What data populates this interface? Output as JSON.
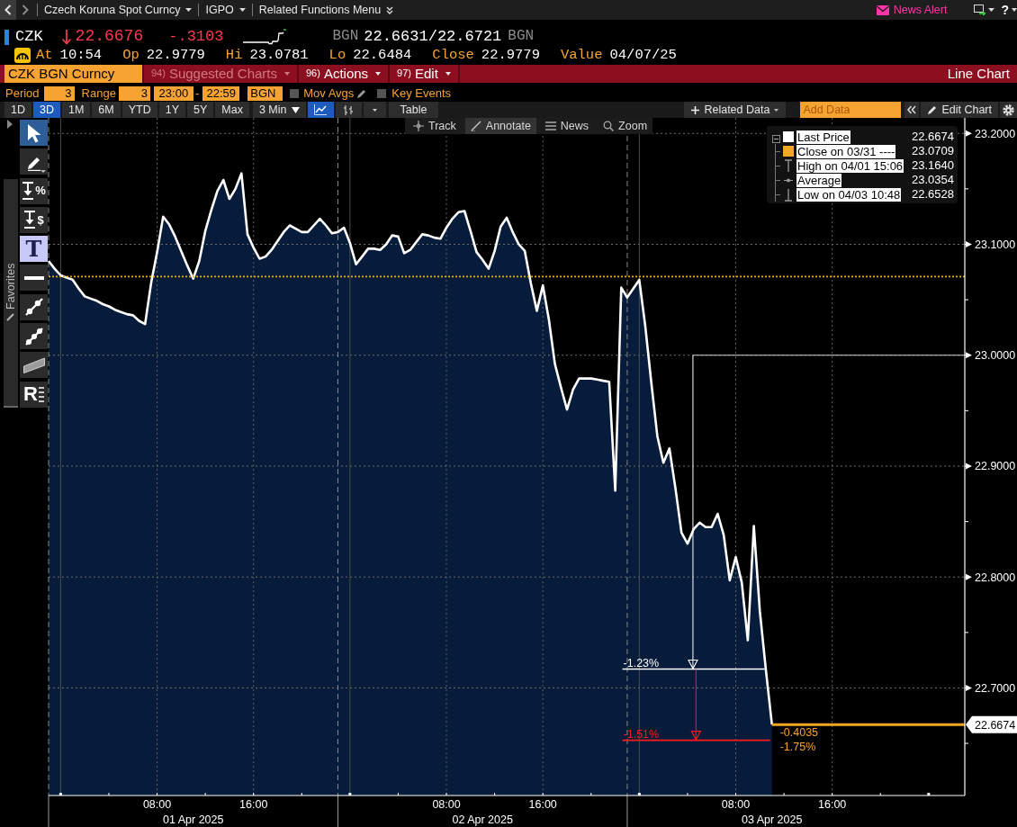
{
  "top_bar": {
    "menus": [
      {
        "label": "Czech Koruna Spot Curncy",
        "kind": "dropdown"
      },
      {
        "label": "IGPO",
        "kind": "dropdown"
      },
      {
        "label": "Related Functions Menu",
        "kind": "menu"
      }
    ],
    "news_alert": "News Alert",
    "help": "?"
  },
  "quote": {
    "ticker": "CZK",
    "down": true,
    "price": "22.6676",
    "change": "-.3103",
    "source_before": "BGN",
    "bid_ask": "22.6631/22.6721",
    "source_after": "BGN"
  },
  "quote_stats": [
    {
      "label": "At",
      "value": "10:54"
    },
    {
      "label": "Op",
      "value": "22.9779"
    },
    {
      "label": "Hi",
      "value": "23.0781"
    },
    {
      "label": "Lo",
      "value": "22.6484"
    },
    {
      "label": "Close",
      "value": "22.9779"
    },
    {
      "label": "Value",
      "value": "04/07/25"
    }
  ],
  "menu_bar": {
    "security": "CZK BGN Curncy",
    "items": [
      {
        "number": "94)",
        "label": "Suggested Charts",
        "disabled": true
      },
      {
        "number": "96)",
        "label": "Actions",
        "disabled": false
      },
      {
        "number": "97)",
        "label": "Edit",
        "disabled": false
      }
    ],
    "chart_type": "Line Chart"
  },
  "settings": {
    "period_label": "Period",
    "period": "3",
    "range_label": "Range",
    "range": "3",
    "start_time": "23:00",
    "time_separator": "-",
    "end_time": "22:59",
    "timezone": "BGN",
    "options": [
      {
        "label": "Mov Avgs",
        "checked": false,
        "editable": true
      },
      {
        "label": "Key Events",
        "checked": false,
        "editable": false
      }
    ]
  },
  "range_bar": {
    "ranges": [
      {
        "label": "1D",
        "selected": false
      },
      {
        "label": "3D",
        "selected": true
      },
      {
        "label": "1M",
        "selected": false
      },
      {
        "label": "6M",
        "selected": false
      },
      {
        "label": "YTD",
        "selected": false
      },
      {
        "label": "1Y",
        "selected": false
      },
      {
        "label": "5Y",
        "selected": false
      },
      {
        "label": "Max",
        "selected": false
      }
    ],
    "interval": "3 Min",
    "styles": [
      {
        "kind": "line",
        "selected": true
      },
      {
        "kind": "bars",
        "selected": false
      }
    ],
    "table": "Table",
    "related_data": "Related Data",
    "add_data_placeholder": "Add Data",
    "edit_chart": "Edit Chart"
  },
  "tools": [
    {
      "kind": "pointer",
      "selected": true,
      "highlighted": false
    },
    {
      "kind": "pencil",
      "selected": false,
      "highlighted": false
    },
    {
      "kind": "percent-drop",
      "glyph": "%",
      "selected": false,
      "highlighted": false
    },
    {
      "kind": "price-drop",
      "glyph": "$",
      "selected": false,
      "highlighted": false
    },
    {
      "kind": "text",
      "glyph": "T",
      "selected": false,
      "highlighted": true
    },
    {
      "kind": "horizontal-line",
      "selected": false,
      "highlighted": false
    },
    {
      "kind": "trend-line",
      "selected": false,
      "highlighted": false
    },
    {
      "kind": "multi-point-line",
      "selected": false,
      "highlighted": false
    },
    {
      "kind": "channel",
      "selected": false,
      "highlighted": false
    },
    {
      "kind": "ray-list",
      "glyph": "R",
      "selected": false,
      "highlighted": false
    }
  ],
  "favorites": "Favorites",
  "chart": {
    "toolbar": [
      {
        "kind": "track",
        "label": "Track",
        "selected": false
      },
      {
        "kind": "annotate",
        "label": "Annotate",
        "selected": true
      },
      {
        "kind": "news",
        "label": "News",
        "selected": false
      },
      {
        "kind": "zoom",
        "label": "Zoom",
        "selected": false
      }
    ],
    "legend": {
      "expanded": true,
      "items": [
        {
          "kind": "swatch",
          "color": "#ffffff",
          "label": "Last Price",
          "value": "22.6674"
        },
        {
          "kind": "swatch",
          "color": "#f5a623",
          "label": "Close on 03/31 ----",
          "value": "23.0709"
        },
        {
          "kind": "high",
          "label": "High on 04/01 15:06",
          "value": "23.1640"
        },
        {
          "kind": "average",
          "label": "Average",
          "value": "23.0354"
        },
        {
          "kind": "low",
          "label": "Low on 04/03 10:48",
          "value": "22.6528"
        }
      ]
    },
    "last_price_tag": "22.6674",
    "date_labels": [
      "01 Apr 2025",
      "02 Apr 2025",
      "03 Apr 2025"
    ],
    "chart_data": {
      "type": "area",
      "grid": true,
      "categories": [
        null,
        null,
        null,
        null,
        null,
        null,
        null,
        null,
        null,
        null,
        null,
        null,
        null,
        null,
        null,
        null,
        null,
        null,
        "08:00",
        null,
        null,
        null,
        null,
        null,
        null,
        null,
        null,
        null,
        null,
        null,
        null,
        null,
        null,
        null,
        "16:00",
        null,
        null,
        null,
        null,
        null,
        null,
        null,
        null,
        null,
        null,
        null,
        null,
        null,
        null,
        null,
        null,
        null,
        null,
        null,
        null,
        null,
        null,
        null,
        null,
        null,
        null,
        null,
        null,
        null,
        null,
        null,
        "08:00",
        null,
        null,
        null,
        null,
        null,
        null,
        null,
        null,
        null,
        null,
        null,
        null,
        null,
        null,
        null,
        "16:00",
        null,
        null,
        null,
        null,
        null,
        null,
        null,
        null,
        null,
        null,
        null,
        null,
        null,
        null,
        null,
        null,
        null,
        null,
        null,
        null,
        null,
        null,
        null,
        null,
        null,
        null,
        null,
        null,
        null,
        null,
        null,
        "08:00",
        null,
        null,
        null,
        null,
        null,
        null,
        null,
        null,
        null,
        null,
        null,
        null,
        null,
        null,
        null,
        "16:00",
        null,
        null,
        null,
        null,
        null,
        null,
        null,
        null,
        null,
        null,
        null,
        null,
        null,
        null,
        null,
        null,
        null,
        null,
        null,
        null,
        null
      ],
      "series": [
        {
          "color": "#ffffff",
          "values": [
            23.085,
            23.078,
            23.072,
            23.07,
            23.068,
            23.06,
            23.053,
            23.051,
            23.049,
            23.046,
            23.044,
            23.041,
            23.039,
            23.037,
            23.036,
            23.031,
            23.028,
            23.065,
            23.093,
            23.125,
            23.118,
            23.107,
            23.094,
            23.081,
            23.069,
            23.085,
            23.112,
            23.131,
            23.148,
            23.158,
            23.141,
            23.15,
            23.164,
            23.109,
            23.097,
            23.087,
            23.089,
            23.095,
            23.103,
            23.111,
            23.117,
            23.114,
            23.111,
            23.111,
            23.117,
            23.123,
            23.117,
            23.11,
            23.111,
            23.115,
            23.101,
            23.082,
            23.089,
            23.096,
            23.096,
            23.095,
            23.1,
            23.108,
            23.107,
            23.092,
            23.095,
            23.102,
            23.109,
            23.108,
            23.106,
            23.105,
            23.115,
            23.123,
            23.129,
            23.13,
            23.112,
            23.093,
            23.086,
            23.078,
            23.094,
            23.116,
            23.124,
            23.111,
            23.1,
            23.094,
            23.065,
            23.04,
            23.063,
            23.032,
            22.992,
            22.971,
            22.951,
            22.969,
            22.979,
            22.979,
            22.979,
            22.978,
            22.977,
            22.976,
            22.878,
            23.061,
            23.052,
            23.06,
            23.068,
            23.026,
            22.975,
            22.927,
            22.903,
            22.916,
            22.88,
            22.84,
            22.83,
            22.843,
            22.849,
            22.845,
            22.845,
            22.857,
            22.838,
            22.797,
            22.818,
            22.795,
            22.743,
            22.846,
            22.769,
            22.716,
            22.667,
            null,
            null,
            null,
            null,
            null,
            null,
            null,
            null,
            null,
            null,
            null,
            null,
            null,
            null,
            null,
            null,
            null,
            null,
            null,
            null,
            null,
            null,
            null,
            null,
            null,
            null,
            null,
            null,
            null,
            null,
            null
          ]
        }
      ],
      "ylim": [
        22.603,
        23.214
      ],
      "yticks": [
        {
          "value": 22.7,
          "label": "22.7000"
        },
        {
          "value": 22.8,
          "label": "22.8000"
        },
        {
          "value": 22.9,
          "label": "22.9000"
        },
        {
          "value": 23.0,
          "label": "23.0000"
        },
        {
          "value": 23.1,
          "label": "23.1000"
        },
        {
          "value": 23.2,
          "label": "23.2000"
        }
      ],
      "ref_lines": [
        {
          "axis": "y",
          "value": 23.0709
        },
        {
          "axis": "y",
          "value": 23.0
        }
      ],
      "annotations": [
        "-1.23%",
        "-1.51%",
        "-0.4035",
        "-1.75%"
      ]
    }
  }
}
